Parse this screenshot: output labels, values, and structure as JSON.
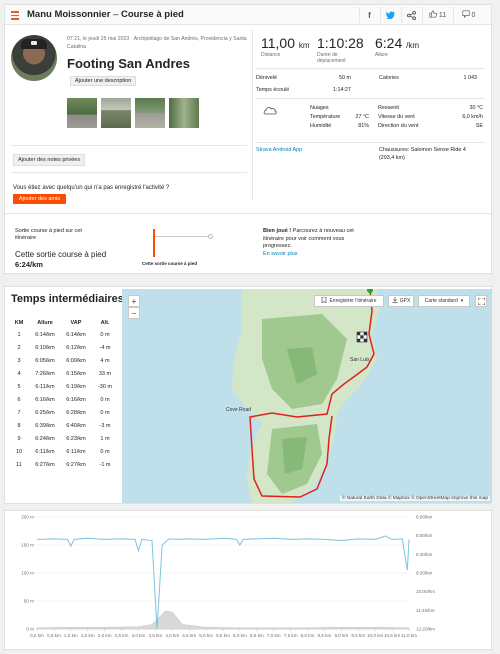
{
  "header": {
    "athlete": "Manu Moissonnier",
    "separator": " – ",
    "activity_type": "Course à pied",
    "kudos_count": "11",
    "comments_count": "0"
  },
  "activity": {
    "datetime_location": "07:21, le jeudi 25 mai 2023 · Archipiélago de San Andrés, Providencia y Santa Catalina",
    "title": "Footing San Andres",
    "add_description": "Ajouter une description",
    "add_private_notes": "Ajouter des notes privées",
    "unrecorded_prompt": "Vous étiez avec quelqu'un qui n'a pas enregistré l'activité ?",
    "add_friends": "Ajouter des amis"
  },
  "stats": {
    "distance": {
      "value": "11,00",
      "unit": "km",
      "label": "Distance"
    },
    "moving_time": {
      "value": "1:10:28",
      "label": "Durée de déplacement"
    },
    "pace": {
      "value": "6:24",
      "unit": "/km",
      "label": "Allure"
    },
    "elevation_label": "Dénivelé",
    "elevation_value": "50 m",
    "calories_label": "Calories",
    "calories_value": "1 043",
    "elapsed_label": "Temps écoulé",
    "elapsed_value": "1:14:27",
    "weather": {
      "condition": "Nuages",
      "temperature_label": "Température",
      "temperature_value": "27 °C",
      "humidity_label": "Humidité",
      "humidity_value": "81%",
      "feels_label": "Ressenti",
      "feels_value": "30 °C",
      "wind_speed_label": "Vitesse du vent",
      "wind_speed_value": "6,0 km/h",
      "wind_dir_label": "Direction du vent",
      "wind_dir_value": "SE"
    },
    "device": "Strava Android App",
    "shoes": "Chaussures: Salomon Sense Ride 4",
    "shoes_distance": "(293,4 km)"
  },
  "segment": {
    "line1": "Sortie course à pied sur cet",
    "line2": "itinéraire",
    "name": "Cette sortie course à pied",
    "pace": "6:24/km",
    "bar_label": "Cette sortie course à pied",
    "bravo": "Bien joué !",
    "msg": " Parcourez à nouveau cet itinéraire pour voir comment vous progressez.",
    "learn_more": "En savoir plus"
  },
  "splits": {
    "title": "Temps intermédiaires",
    "headers": [
      "KM",
      "Allure",
      "VAP",
      "Alt."
    ],
    "rows": [
      [
        "1",
        "6:14/km",
        "6:14/km",
        "0 m"
      ],
      [
        "2",
        "6:10/km",
        "6:12/km",
        "-4 m"
      ],
      [
        "3",
        "6:05/km",
        "6:00/km",
        "4 m"
      ],
      [
        "4",
        "7:26/km",
        "6:15/km",
        "33 m"
      ],
      [
        "5",
        "6:11/km",
        "6:19/km",
        "-30 m"
      ],
      [
        "6",
        "6:16/km",
        "6:16/km",
        "0 m"
      ],
      [
        "7",
        "6:25/km",
        "6:28/km",
        "0 m"
      ],
      [
        "8",
        "6:39/km",
        "6:40/km",
        "-3 m"
      ],
      [
        "9",
        "6:24/km",
        "6:23/km",
        "1 m"
      ],
      [
        "10",
        "6:11/km",
        "6:11/km",
        "0 m"
      ],
      [
        "11",
        "6:27/km",
        "6:27/km",
        "-1 m"
      ]
    ]
  },
  "map": {
    "zoom_in": "+",
    "zoom_out": "−",
    "save_route": "Enregistrer l'itinéraire",
    "gpx": "GPX",
    "map_style": "Carte standard",
    "place_cove": "Cove Road",
    "place_san_luis": "San Luis",
    "attribution": "© Natural Earth Data © Mapbox © OpenStreetMap Improve this map"
  },
  "colors": {
    "accent": "#fc4c02",
    "link": "#007fb6",
    "pace_line": "#7cc3df",
    "elevation_fill": "#d9d9d9"
  },
  "chart_data": {
    "type": "line",
    "x_ticks": [
      "0,0 km",
      "0,5 km",
      "1,0 km",
      "1,5 km",
      "2,0 km",
      "2,5 km",
      "3,0 km",
      "3,5 km",
      "4,0 km",
      "4,5 km",
      "5,0 km",
      "5,5 km",
      "6,0 km",
      "6,5 km",
      "7,0 km",
      "7,5 km",
      "8,0 km",
      "8,5 km",
      "9,0 km",
      "9,5 km",
      "10,0 km",
      "10,5 km",
      "11,0 km"
    ],
    "xlim": [
      0,
      11
    ],
    "left_ticks": [
      "200 m",
      "150 m",
      "100 m",
      "50 m",
      "0 m"
    ],
    "right_ticks": [
      "6:00/km",
      "8:00/km",
      "8:40/km",
      "9:20/km",
      "10:00/km",
      "11:40/km",
      "12:20/km"
    ],
    "elevation": {
      "x": [
        0,
        1,
        2,
        3,
        3.4,
        3.6,
        3.8,
        4.0,
        4.3,
        5,
        6,
        7,
        8,
        9,
        10,
        11
      ],
      "y": [
        2,
        3,
        3,
        4,
        8,
        20,
        32,
        30,
        8,
        3,
        2,
        2,
        2,
        3,
        3,
        2
      ]
    },
    "pace": {
      "x": [
        0,
        0.5,
        0.9,
        1.0,
        1.1,
        1.5,
        2.0,
        2.5,
        2.9,
        3.0,
        3.1,
        3.4,
        3.55,
        3.7,
        3.9,
        4.2,
        4.5,
        5.0,
        5.5,
        5.9,
        6.0,
        6.1,
        6.5,
        7.0,
        7.5,
        8.0,
        8.5,
        9.0,
        9.5,
        10.0,
        10.3,
        10.5,
        10.8,
        10.95,
        11.0
      ],
      "y": [
        160,
        161,
        160,
        148,
        160,
        162,
        160,
        161,
        160,
        140,
        160,
        158,
        0,
        150,
        161,
        160,
        161,
        160,
        162,
        160,
        150,
        160,
        161,
        162,
        160,
        161,
        160,
        158,
        161,
        160,
        166,
        160,
        161,
        105,
        160
      ]
    }
  }
}
